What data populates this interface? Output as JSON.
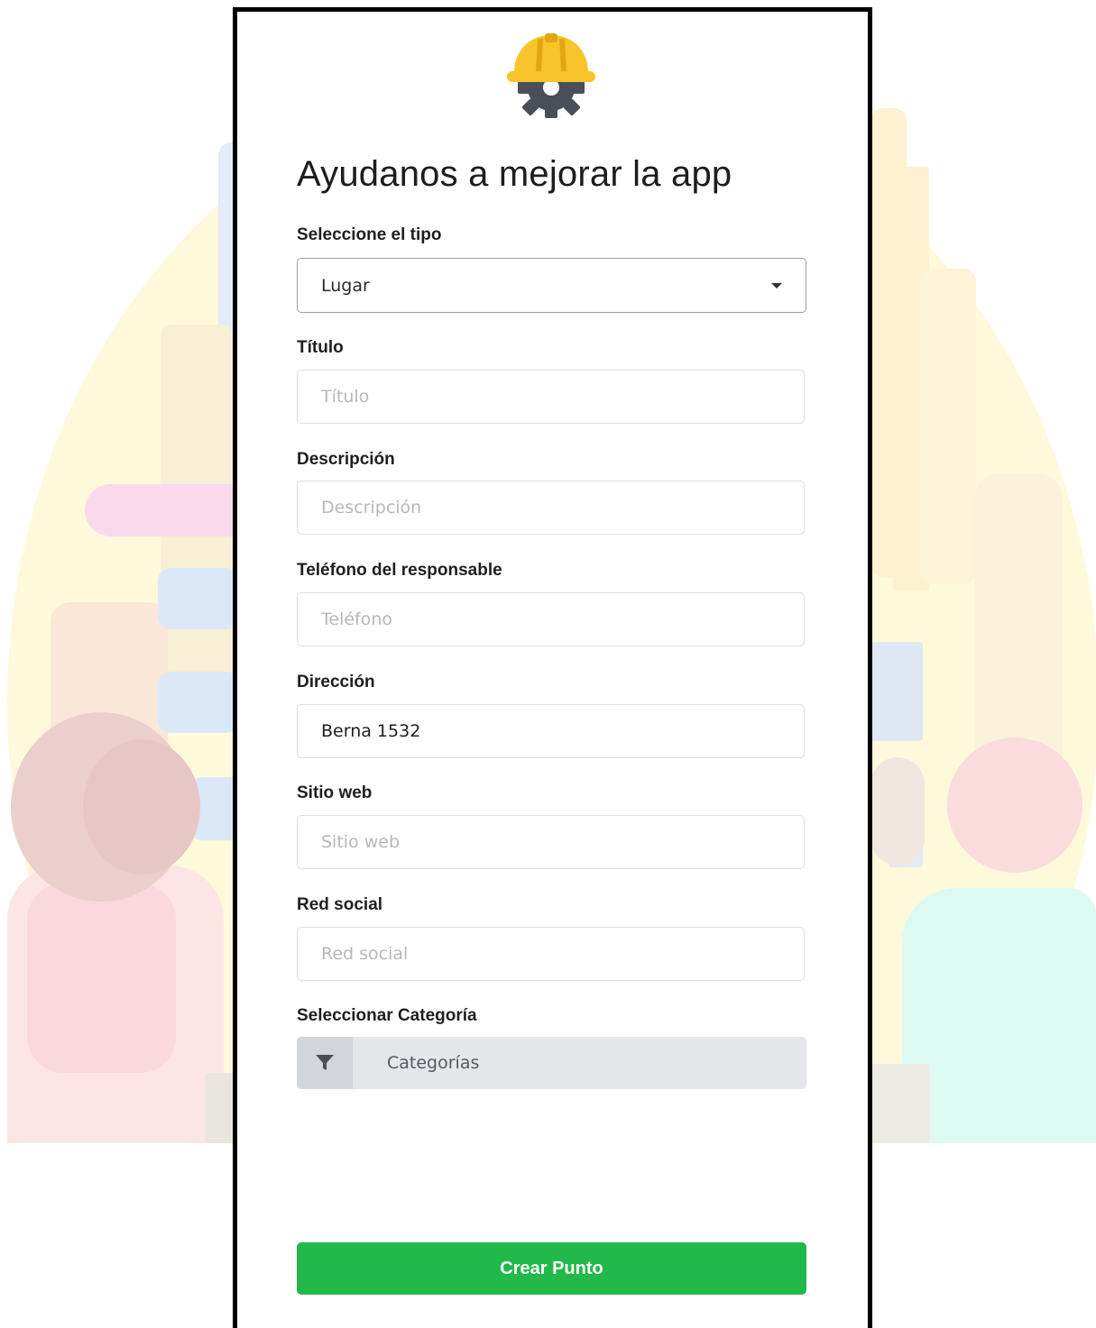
{
  "form": {
    "title": "Ayudanos a mejorar la app",
    "type_label": "Seleccione el tipo",
    "type_value": "Lugar",
    "title_label": "Título",
    "title_placeholder": "Título",
    "description_label": "Descripción",
    "description_placeholder": "Descripción",
    "phone_label": "Teléfono del responsable",
    "phone_placeholder": "Teléfono",
    "address_label": "Dirección",
    "address_value": "Berna 1532",
    "website_label": "Sitio web",
    "website_placeholder": "Sitio web",
    "social_label": "Red social",
    "social_placeholder": "Red social",
    "category_label": "Seleccionar Categoría",
    "category_placeholder": "Categorías",
    "submit_label": "Crear Punto"
  },
  "icons": {
    "logo": "helmet-gear-icon",
    "caret": "chevron-down-icon",
    "filter": "filter-icon"
  },
  "colors": {
    "primary_button": "#22b94a",
    "helmet": "#f7c52b",
    "gear": "#4a4f57"
  }
}
